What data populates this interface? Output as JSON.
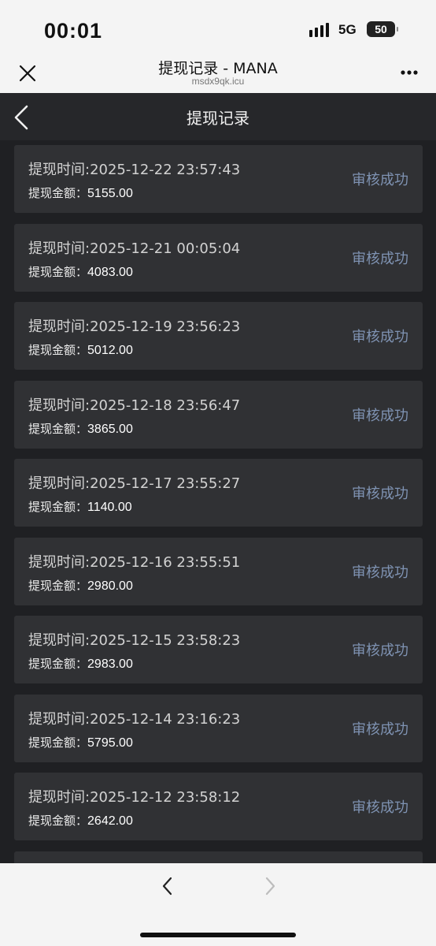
{
  "status_bar": {
    "time": "00:01",
    "network": "5G",
    "battery": "50"
  },
  "browser": {
    "title": "提现记录 - MANA",
    "url": "msdx9qk.icu"
  },
  "page": {
    "title": "提现记录"
  },
  "records": [
    {
      "time_label": "提现时间:2025-12-22 23:57:43",
      "amount_label": "提现金额：",
      "amount": "5155.00",
      "status": "审核成功"
    },
    {
      "time_label": "提现时间:2025-12-21 00:05:04",
      "amount_label": "提现金额：",
      "amount": "4083.00",
      "status": "审核成功"
    },
    {
      "time_label": "提现时间:2025-12-19 23:56:23",
      "amount_label": "提现金额：",
      "amount": "5012.00",
      "status": "审核成功"
    },
    {
      "time_label": "提现时间:2025-12-18 23:56:47",
      "amount_label": "提现金额：",
      "amount": "3865.00",
      "status": "审核成功"
    },
    {
      "time_label": "提现时间:2025-12-17 23:55:27",
      "amount_label": "提现金额：",
      "amount": "1140.00",
      "status": "审核成功"
    },
    {
      "time_label": "提现时间:2025-12-16 23:55:51",
      "amount_label": "提现金额：",
      "amount": "2980.00",
      "status": "审核成功"
    },
    {
      "time_label": "提现时间:2025-12-15 23:58:23",
      "amount_label": "提现金额：",
      "amount": "2983.00",
      "status": "审核成功"
    },
    {
      "time_label": "提现时间:2025-12-14 23:16:23",
      "amount_label": "提现金额：",
      "amount": "5795.00",
      "status": "审核成功"
    },
    {
      "time_label": "提现时间:2025-12-12 23:58:12",
      "amount_label": "提现金额：",
      "amount": "2642.00",
      "status": "审核成功"
    }
  ],
  "icons": {
    "close": "close-icon",
    "more": "more-icon",
    "back": "chevron-left-icon",
    "nav_back": "chevron-left-icon",
    "nav_forward": "chevron-right-icon"
  },
  "colors": {
    "app_background": "#1f2023",
    "card_background": "#303134",
    "status_success": "#7f93b3"
  }
}
